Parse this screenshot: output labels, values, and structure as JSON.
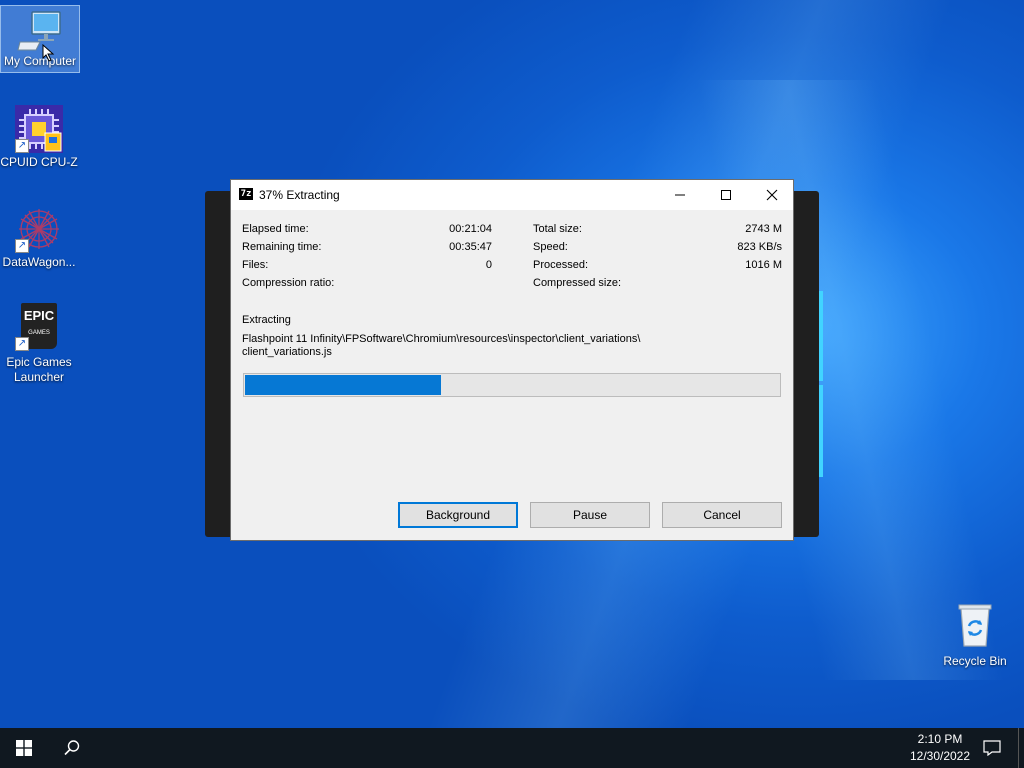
{
  "desktop": {
    "icons": [
      {
        "label": "My Computer",
        "icon": "monitor-icon"
      },
      {
        "label": "CPUID CPU-Z",
        "icon": "cpu-icon"
      },
      {
        "label": "DataWagon...",
        "icon": "datawagon-icon"
      },
      {
        "label": "Epic Games Launcher",
        "icon": "epic-games-icon",
        "logo_top": "EPIC",
        "logo_bottom": "GAMES"
      },
      {
        "label": "Recycle Bin",
        "icon": "recycle-bin-icon"
      }
    ]
  },
  "dialog": {
    "app_icon": "7z",
    "title": "37% Extracting",
    "stats_left": [
      {
        "label": "Elapsed time:",
        "value": "00:21:04"
      },
      {
        "label": "Remaining time:",
        "value": "00:35:47"
      },
      {
        "label": "Files:",
        "value": "0"
      },
      {
        "label": "Compression ratio:",
        "value": ""
      }
    ],
    "stats_right": [
      {
        "label": "Total size:",
        "value": "2743 M"
      },
      {
        "label": "Speed:",
        "value": "823 KB/s"
      },
      {
        "label": "Processed:",
        "value": "1016 M"
      },
      {
        "label": "Compressed size:",
        "value": ""
      }
    ],
    "status_label": "Extracting",
    "current_path_line1": "Flashpoint 11 Infinity\\FPSoftware\\Chromium\\resources\\inspector\\client_variations\\",
    "current_path_line2": "client_variations.js",
    "progress_percent": 37,
    "buttons": {
      "background": "Background",
      "pause": "Pause",
      "cancel": "Cancel"
    }
  },
  "taskbar": {
    "time": "2:10 PM",
    "date": "12/30/2022"
  },
  "colors": {
    "accent": "#0078d7",
    "progress": "#0678d4",
    "taskbar": "#101820",
    "desktop": "#1a78e8"
  }
}
